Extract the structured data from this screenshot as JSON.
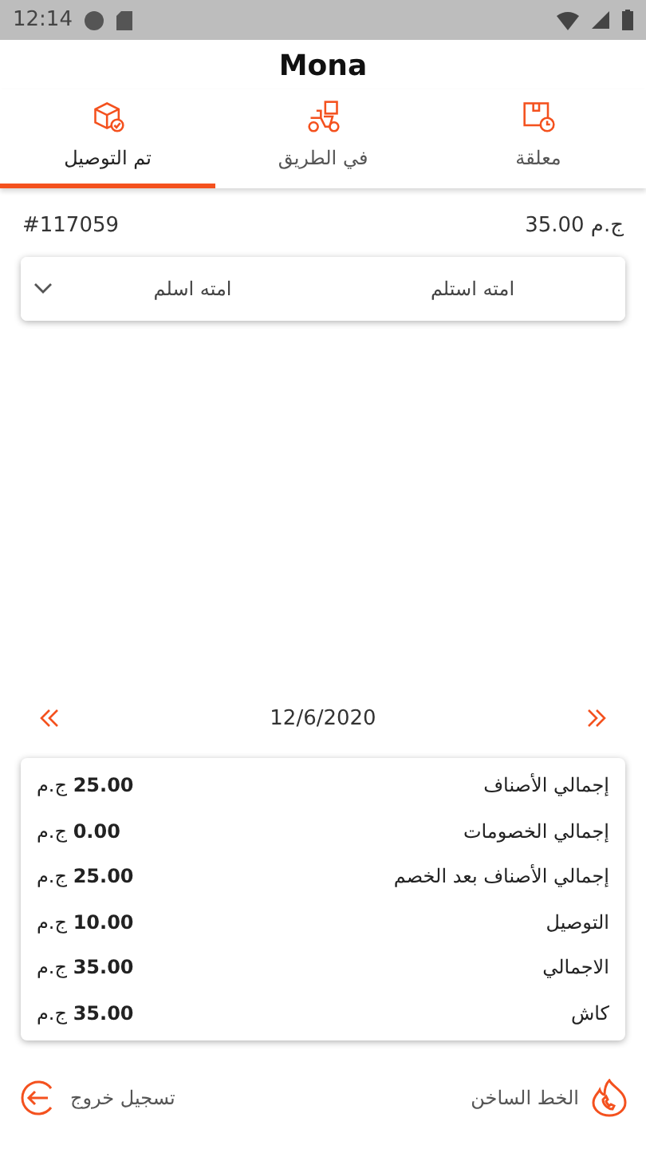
{
  "status_bar": {
    "time": "12:14"
  },
  "header": {
    "title": "Mona"
  },
  "tabs": [
    {
      "label": "معلقة",
      "kind": "pending",
      "selected": false
    },
    {
      "label": "في الطريق",
      "kind": "onway",
      "selected": false
    },
    {
      "label": "تم التوصيل",
      "kind": "delivered",
      "selected": true
    }
  ],
  "order": {
    "total": "35.00 ج.م",
    "number": "#117059",
    "customer": "امته استلم",
    "address": "امته اسلم",
    "expanded": false
  },
  "date_nav": {
    "date": "12/6/2020"
  },
  "summary": [
    {
      "label": "إجمالي الأصناف",
      "value": "**25.00** ج.م"
    },
    {
      "label": "إجمالي الخصومات",
      "value": "**0.00** ج.م"
    },
    {
      "label": "إجمالي الأصناف بعد الخصم",
      "value": "**25.00** ج.م"
    },
    {
      "label": "التوصيل",
      "value": "**10.00** ج.م"
    },
    {
      "label": "الاجمالي",
      "value": "**35.00** ج.م"
    },
    {
      "label": "كاش",
      "value": "**35.00** ج.م"
    }
  ],
  "footer": {
    "hotline": "الخط الساخن",
    "logout": "تسجيل خروج"
  }
}
